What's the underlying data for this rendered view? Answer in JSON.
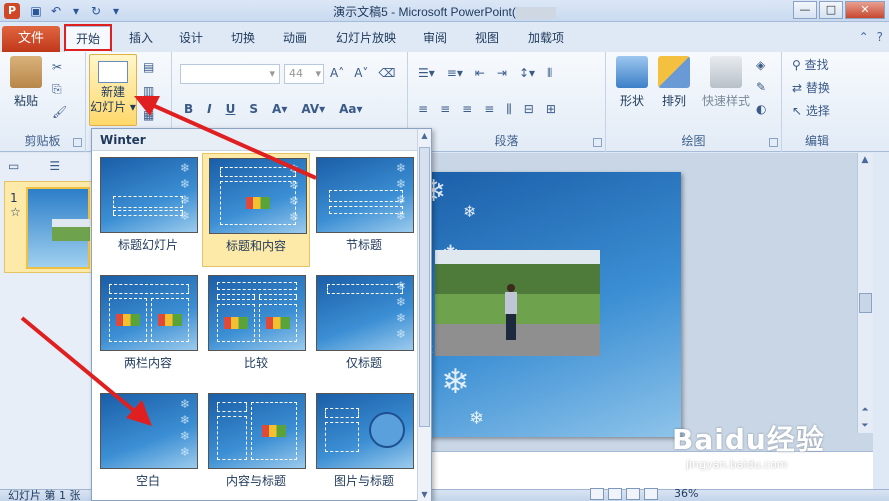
{
  "window": {
    "title_prefix": "演示文稿5  -  Microsoft PowerPoint(",
    "minimize": "—",
    "maximize": "□",
    "close": "✕"
  },
  "tabs": {
    "file": "文件",
    "items": [
      "开始",
      "插入",
      "设计",
      "切换",
      "动画",
      "幻灯片放映",
      "审阅",
      "视图",
      "加载项"
    ]
  },
  "ribbon": {
    "clipboard": {
      "paste": "粘贴",
      "label": "剪贴板"
    },
    "slides": {
      "new_slide_line1": "新建",
      "new_slide_line2": "幻灯片",
      "arrow": "▾"
    },
    "font": {
      "size": "44",
      "bold": "B",
      "italic": "I",
      "underline": "U",
      "strike": "S",
      "grow": "A˄",
      "shrink": "A˅"
    },
    "paragraph": {
      "label": "段落"
    },
    "drawing": {
      "shape": "形状",
      "arrange": "排列",
      "quick_style": "快速样式",
      "label": "绘图"
    },
    "editing": {
      "find": "查找",
      "replace": "替换",
      "select": "选择",
      "label": "编辑"
    }
  },
  "gallery": {
    "header": "Winter",
    "layouts": [
      {
        "name": "标题幻灯片"
      },
      {
        "name": "标题和内容"
      },
      {
        "name": "节标题"
      },
      {
        "name": "两栏内容"
      },
      {
        "name": "比较"
      },
      {
        "name": "仅标题"
      },
      {
        "name": "空白"
      },
      {
        "name": "内容与标题"
      },
      {
        "name": "图片与标题"
      }
    ],
    "selected_index": 1
  },
  "slide_panel": {
    "slide_number": "1",
    "star": "☆"
  },
  "statusbar": {
    "left": "幻灯片 第 1 张",
    "zoom": "36%"
  },
  "watermark": {
    "big": "Baidu经验",
    "small": "jingyan.baidu.com"
  }
}
